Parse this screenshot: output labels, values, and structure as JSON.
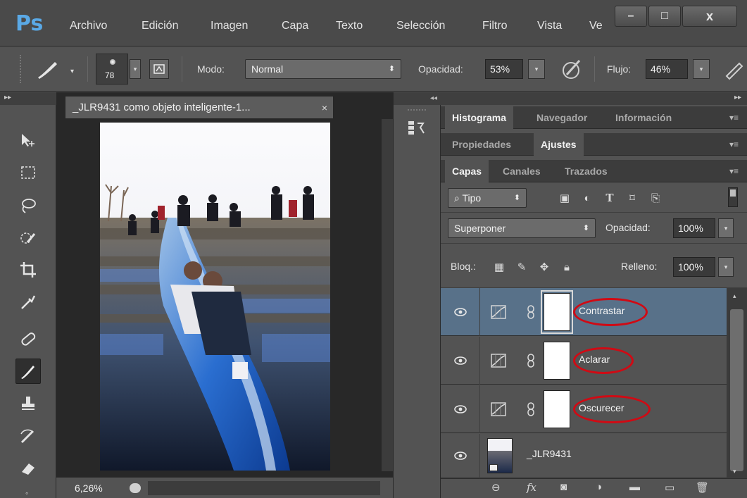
{
  "app": {
    "logo": "Ps",
    "menu": [
      "Archivo",
      "Edición",
      "Imagen",
      "Capa",
      "Texto",
      "Selección",
      "Filtro",
      "Vista",
      "Ve"
    ],
    "window_controls": {
      "minimize": "–",
      "maximize": "□",
      "close": "x"
    }
  },
  "options": {
    "brush_size": "78",
    "mode_label": "Modo:",
    "mode_value": "Normal",
    "opacity_label": "Opacidad:",
    "opacity_value": "53%",
    "flow_label": "Flujo:",
    "flow_value": "46%"
  },
  "document": {
    "tab_title": "_JLR9431 como objeto inteligente-1...",
    "tab_close": "×",
    "zoom": "6,26%"
  },
  "panels": {
    "group1": [
      "Histograma",
      "Navegador",
      "Información"
    ],
    "group2": [
      "Propiedades",
      "Ajustes"
    ],
    "group3": [
      "Capas",
      "Canales",
      "Trazados"
    ],
    "filter_label": "Tipo",
    "blend_mode": "Superponer",
    "opacity_label": "Opacidad:",
    "opacity_value": "100%",
    "lock_label": "Bloq.:",
    "fill_label": "Relleno:",
    "fill_value": "100%"
  },
  "layers": [
    {
      "name": "Contrastar",
      "selected": true
    },
    {
      "name": "Aclarar",
      "selected": false
    },
    {
      "name": "Oscurecer",
      "selected": false
    },
    {
      "name": "_JLR9431",
      "selected": false
    }
  ],
  "colors": {
    "accent_selected_layer": "#587189",
    "annotation_red": "#d00a14",
    "ps_logo_blue": "#5aa9e6"
  }
}
